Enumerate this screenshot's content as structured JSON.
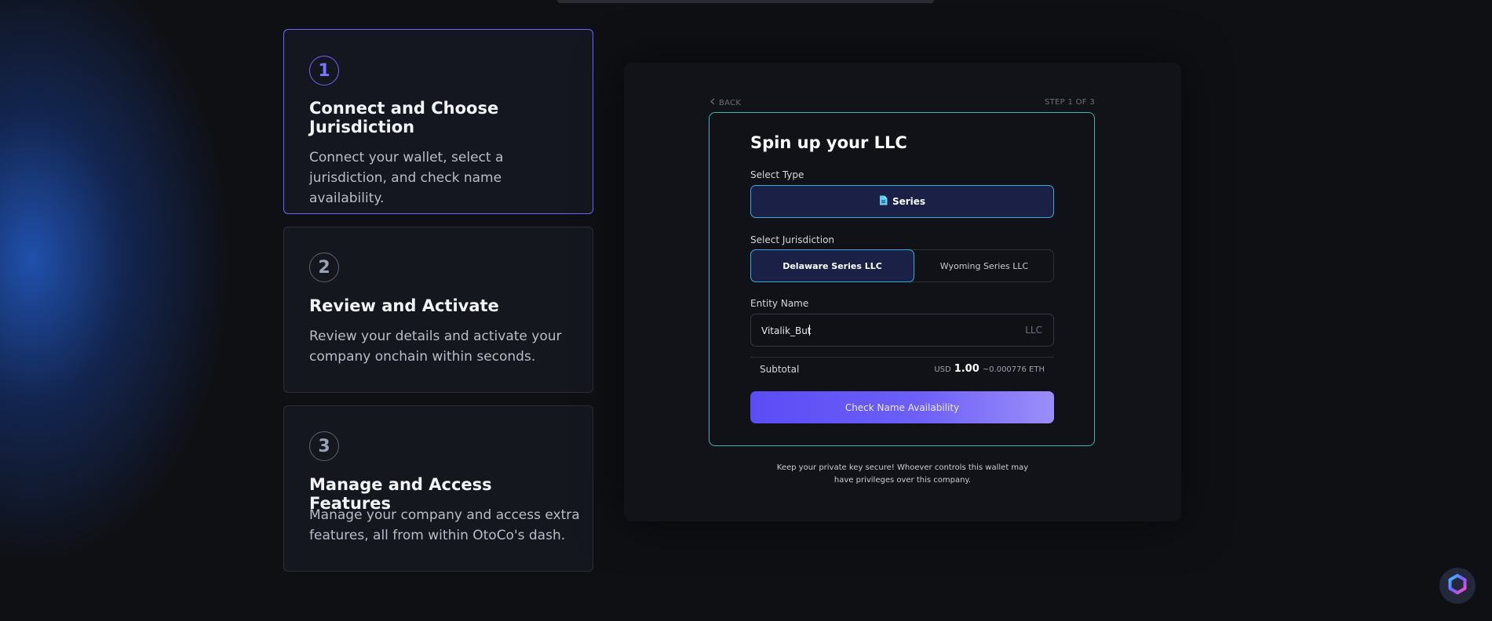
{
  "steps": [
    {
      "number": "1",
      "title": "Connect and Choose Jurisdiction",
      "description": "Connect your wallet, select a jurisdiction, and check name availability."
    },
    {
      "number": "2",
      "title": "Review and Activate",
      "description": "Review your details and activate your company onchain within seconds."
    },
    {
      "number": "3",
      "title": "Manage and Access Features",
      "description": "Manage your company and access extra features, all from within OtoCo's dash."
    }
  ],
  "nav": {
    "back_label": "BACK",
    "step_indicator": "STEP 1 OF 3"
  },
  "form": {
    "title": "Spin up your LLC",
    "type_label": "Select Type",
    "type_selected": "Series",
    "jurisdiction_label": "Select Jurisdiction",
    "jurisdictions": [
      "Delaware Series LLC",
      "Wyoming Series LLC"
    ],
    "jurisdiction_selected": "Delaware Series LLC",
    "entity_label": "Entity Name",
    "entity_value": "Vitalik_But",
    "entity_suffix": "LLC",
    "subtotal_label": "Subtotal",
    "currency": "USD",
    "amount": "1.00",
    "eth_amount": "~0.000776 ETH",
    "submit_label": "Check Name Availability"
  },
  "disclaimer": "Keep your private key secure! Whoever controls this wallet may have privileges over this company.",
  "colors": {
    "accent": "#6c63ff",
    "card_border": "#3fb3ad",
    "selected_border": "#38a8d8",
    "selected_bg": "#1b2146"
  },
  "icons": {
    "type_icon": "document-icon",
    "back_icon": "chevron-left-icon",
    "fab_icon": "chat-widget-icon"
  }
}
